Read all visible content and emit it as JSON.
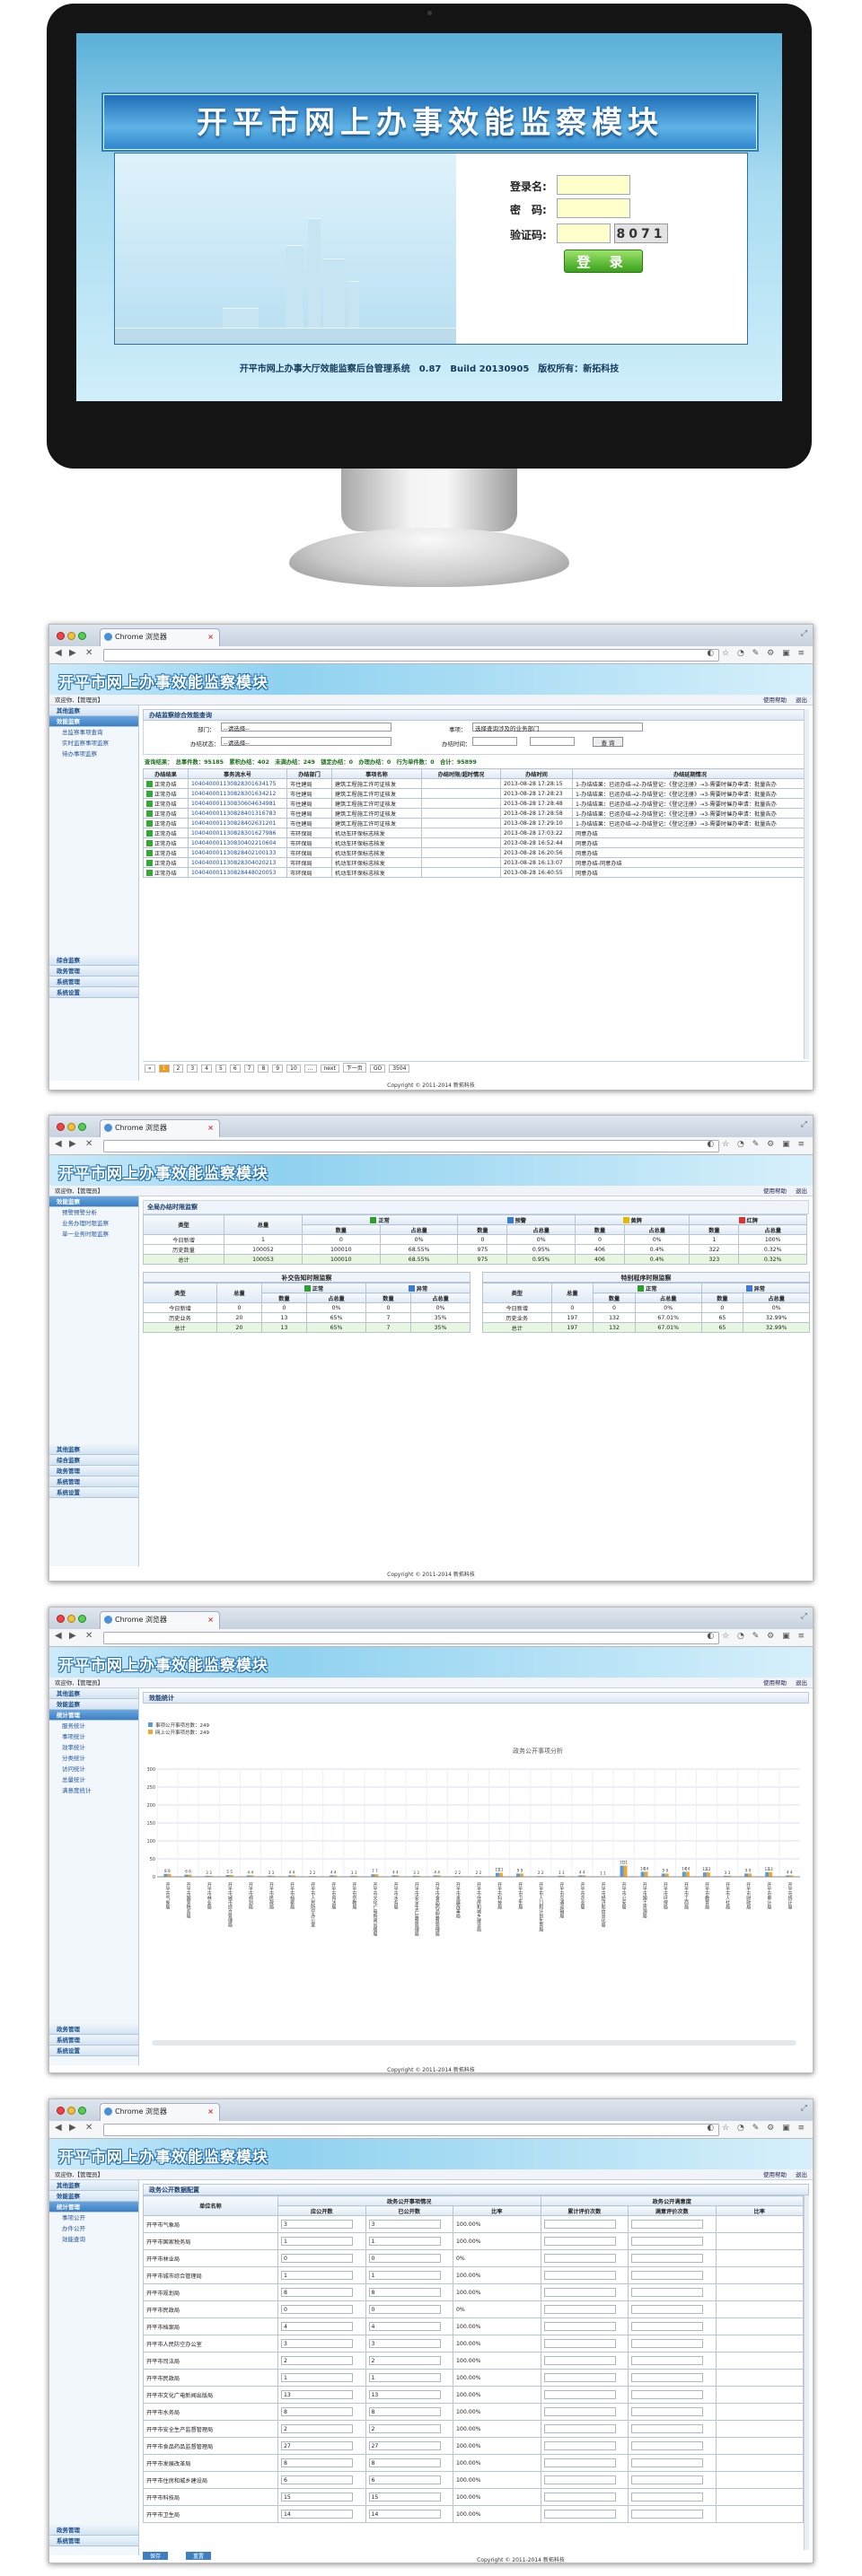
{
  "login": {
    "title": "开平市网上办事效能监察模块",
    "username_label": "登录名:",
    "password_label": "密　码:",
    "captcha_label": "验证码:",
    "captcha_value": "8071",
    "login_button": "登 录",
    "footer": "开平市网上办事大厅效能监察后台管理系统　0.87　Build 20130905　版权所有：新拓科技"
  },
  "browser": {
    "tab_title": "Chrome 浏览器",
    "tab_close": "×",
    "back": "◀",
    "forward": "▶",
    "stop": "✕"
  },
  "app": {
    "title": "开平市网上办事效能监察模块",
    "user": "欢迎你,【管理员】",
    "help": "使用帮助",
    "logout": "退出",
    "copyright": "Copyright © 2011-2014 新拓科技"
  },
  "screen1": {
    "sidebar_top": [
      "其他监察",
      "效能监察"
    ],
    "sidebar_items": [
      "总监察事项查询",
      "实时监察事项监察",
      "待办事项监察"
    ],
    "sidebar_bottom": [
      "综合监察",
      "政务管理",
      "系统管理",
      "系统设置"
    ],
    "page_title": "办结监察综合效能查询",
    "filter_dept_label": "部门：",
    "filter_dept_value": "--请选择--",
    "filter_item_label": "事项：",
    "filter_item_value": "选择查询涉及的业务部门",
    "filter_status_label": "办结状态：",
    "filter_status_value": "--请选择--",
    "filter_date_label": "办结时间：",
    "search_button": "查 询",
    "summary": "查询结果：　总事件数：95185　累积办结：402　未满办结：249　锁定办结：0　办理办结：0　行为单件数：0　合计：95899",
    "columns": [
      "办结结果",
      "事务流水号",
      "办结部门",
      "事项名称",
      "办结时限/超时情况",
      "办结时间",
      "办结延期情况"
    ],
    "rows": [
      [
        "正常办结",
        "104040001130828301634175",
        "市住建局",
        "建筑工程施工许可证核发",
        "",
        "2013-08-28 17:28:15",
        "1-办结结果：已运办结→2-办结登记：《登记注册》→3-需要时催办申请：批量告办"
      ],
      [
        "正常办结",
        "104040001130828301634212",
        "市住建局",
        "建筑工程施工许可证核发",
        "",
        "2013-08-28 17:28:23",
        "1-办结结果：已运办结→2-办结登记：《登记注册》→3-需要时催办申请：批量告办"
      ],
      [
        "正常办结",
        "104040001130830604634981",
        "市住建局",
        "建筑工程施工许可证核发",
        "",
        "2013-08-28 17:28:48",
        "1-办结结果：已运办结→2-办结登记：《登记注册》→3-需要时催办申请：批量告办"
      ],
      [
        "正常办结",
        "104040001130828401316783",
        "市住建局",
        "建筑工程施工许可证核发",
        "",
        "2013-08-28 17:28:58",
        "1-办结结果：已运办结→2-办结登记：《登记注册》→3-需要时催办申请：批量告办"
      ],
      [
        "正常办结",
        "104040001130828402631201",
        "市住建局",
        "建筑工程施工许可证核发",
        "",
        "2013-08-28 17:29:10",
        "1-办结结果：已运办结→2-办结登记：《登记注册》→3-需要时催办申请：批量告办"
      ],
      [
        "正常办结",
        "104040001130828301627986",
        "市环保局",
        "机动车环保标志核发",
        "",
        "2013-08-28 17:03:22",
        "同意办结"
      ],
      [
        "正常办结",
        "104040001130830402210604",
        "市环保局",
        "机动车环保标志核发",
        "",
        "2013-08-28 16:52:44",
        "同意办结"
      ],
      [
        "正常办结",
        "104040001130828402100133",
        "市环保局",
        "机动车环保标志核发",
        "",
        "2013-08-28 16:20:56",
        "同意办结"
      ],
      [
        "正常办结",
        "104040001130828304020213",
        "市环保局",
        "机动车环保标志核发",
        "",
        "2013-08-28 16:13:07",
        "同意办结-同意办结"
      ],
      [
        "正常办结",
        "104040001130828448020053",
        "市环保局",
        "机动车环保标志核发",
        "",
        "2013-08-28 16:40:55",
        "同意办结"
      ]
    ],
    "pager": [
      "«",
      "1",
      "2",
      "3",
      "4",
      "5",
      "6",
      "7",
      "8",
      "9",
      "10",
      "...",
      "next",
      "下一页",
      "GO",
      "3504"
    ]
  },
  "screen2": {
    "sidebar_top": [
      "效能监察"
    ],
    "sidebar_items": [
      "预警预警分析",
      "业务办理时限监察",
      "单一业务时限监察"
    ],
    "sidebar_bottom": [
      "其他监察",
      "综合监察",
      "政务管理",
      "系统管理",
      "系统设置"
    ],
    "table1_title": "全局办结时限监察",
    "table1_groups": [
      "正常",
      "预警",
      "黄牌",
      "红牌"
    ],
    "table1_sub": [
      "数量",
      "占总量"
    ],
    "col_type": "类型",
    "col_total": "总量",
    "table1_rows": [
      [
        "今日新增",
        "1",
        "0",
        "0%",
        "0",
        "0%",
        "0",
        "0%",
        "1",
        "100%"
      ],
      [
        "历史数量",
        "100052",
        "100010",
        "68.55%",
        "975",
        "0.95%",
        "406",
        "0.4%",
        "322",
        "0.32%"
      ],
      [
        "总计",
        "100053",
        "100010",
        "68.55%",
        "975",
        "0.95%",
        "406",
        "0.4%",
        "323",
        "0.32%"
      ]
    ],
    "table2_title": "补交告知时限监察",
    "table3_title": "特别程序时限监察",
    "small_groups": [
      "正常",
      "异常"
    ],
    "table2_rows": [
      [
        "今日新增",
        "0",
        "0",
        "0%",
        "0",
        "0%"
      ],
      [
        "历史业务",
        "20",
        "13",
        "65%",
        "7",
        "35%"
      ],
      [
        "总计",
        "20",
        "13",
        "65%",
        "7",
        "35%"
      ]
    ],
    "table3_rows": [
      [
        "今日新增",
        "0",
        "0",
        "0%",
        "0",
        "0%"
      ],
      [
        "历史业务",
        "197",
        "132",
        "67.01%",
        "65",
        "32.99%"
      ],
      [
        "总计",
        "197",
        "132",
        "67.01%",
        "65",
        "32.99%"
      ]
    ]
  },
  "screen3": {
    "sidebar_top": [
      "其他监察",
      "效能监察",
      "统计管理"
    ],
    "sidebar_items": [
      "服务统计",
      "事项统计",
      "效率统计",
      "分类统计",
      "访问统计",
      "总量统计",
      "满意度统计"
    ],
    "sidebar_bottom": [
      "政务管理",
      "系统管理",
      "系统设置"
    ],
    "page_title": "效能统计"
  },
  "screen4": {
    "sidebar_top": [
      "其他监察",
      "效能监察",
      "统计管理"
    ],
    "sidebar_items": [
      "事项公开",
      "办件公开",
      "效能查询"
    ],
    "sidebar_bottom": [
      "政务管理",
      "系统管理"
    ],
    "page_title": "政务公开数据配置",
    "group1": "政务公开事项情况",
    "group2": "政务公开满意度",
    "columns": [
      "单位名称",
      "应公开数",
      "已公开数",
      "比率",
      "累计评价次数",
      "满意评价次数",
      "比率"
    ],
    "rows": [
      [
        "开平市气象局",
        "3",
        "3",
        "100.00%"
      ],
      [
        "开平市国家税务局",
        "1",
        "1",
        "100.00%"
      ],
      [
        "开平市林业局",
        "0",
        "0",
        "0%"
      ],
      [
        "开平市城市综合管理局",
        "1",
        "1",
        "100.00%"
      ],
      [
        "开平市规划局",
        "8",
        "8",
        "100.00%"
      ],
      [
        "开平市民政局",
        "0",
        "0",
        "0%"
      ],
      [
        "开平市档案局",
        "4",
        "4",
        "100.00%"
      ],
      [
        "开平市人民防空办公室",
        "3",
        "3",
        "100.00%"
      ],
      [
        "开平市司法局",
        "2",
        "2",
        "100.00%"
      ],
      [
        "开平市民政局",
        "1",
        "1",
        "100.00%"
      ],
      [
        "开平市文化广电新闻出版局",
        "13",
        "13",
        "100.00%"
      ],
      [
        "开平市水务局",
        "8",
        "8",
        "100.00%"
      ],
      [
        "开平市安全生产监督管理局",
        "2",
        "2",
        "100.00%"
      ],
      [
        "开平市食品药品监督管理局",
        "27",
        "27",
        "100.00%"
      ],
      [
        "开平市发展改革局",
        "8",
        "8",
        "100.00%"
      ],
      [
        "开平市住房和城乡建设局",
        "6",
        "6",
        "100.00%"
      ],
      [
        "开平市科技局",
        "15",
        "15",
        "100.00%"
      ],
      [
        "开平市卫生局",
        "14",
        "14",
        "100.00%"
      ]
    ],
    "save_button": "保存",
    "reset_button": "重置"
  },
  "chart_data": {
    "type": "bar",
    "title": "政务公开事项分析",
    "legend": [
      "事项公开事项总数：249",
      "网上公开事项总数：249"
    ],
    "colors": [
      "#5b9bd5",
      "#f0a830"
    ],
    "ylim": [
      0,
      300
    ],
    "yticks": [
      0,
      50,
      100,
      150,
      200,
      250,
      300
    ],
    "categories": [
      "开平市气象局",
      "开平市国家税务局",
      "开平市林业局",
      "开平市城市综合管理局",
      "开平市规划局",
      "开平市民政局",
      "开平市档案局",
      "开平市人民防空办公室",
      "开平市司法局",
      "开平市宗教局",
      "开平市文化广电新闻出版局",
      "开平市水务局",
      "开平市安全生产监督管理局",
      "开平市食品药品监督管理局",
      "开平市发展改革局",
      "开平市住房和城乡建设局",
      "开平市科技局",
      "开平市卫生局",
      "开平市人口和计划生育局",
      "开平市交通运输局",
      "开平市农业局",
      "开平市经济和信息化局",
      "开平市公安局",
      "开平市国土资源局",
      "开平市环保局",
      "开平市工商局",
      "开平市教育局",
      "开平市人社局",
      "开平市财政局",
      "开平市审计局",
      "开平市统计局"
    ],
    "series": [
      {
        "values": [
          8,
          6,
          3,
          5,
          4,
          3,
          4,
          2,
          4,
          3,
          7,
          4,
          3,
          4,
          2,
          2,
          11,
          9,
          2,
          3,
          4,
          1,
          31,
          14,
          9,
          14,
          12,
          3,
          9,
          13,
          4
        ]
      },
      {
        "values": [
          8,
          6,
          3,
          5,
          4,
          3,
          4,
          2,
          4,
          3,
          7,
          4,
          3,
          4,
          2,
          2,
          11,
          9,
          2,
          3,
          4,
          1,
          31,
          14,
          9,
          14,
          12,
          3,
          9,
          13,
          4
        ]
      }
    ]
  }
}
